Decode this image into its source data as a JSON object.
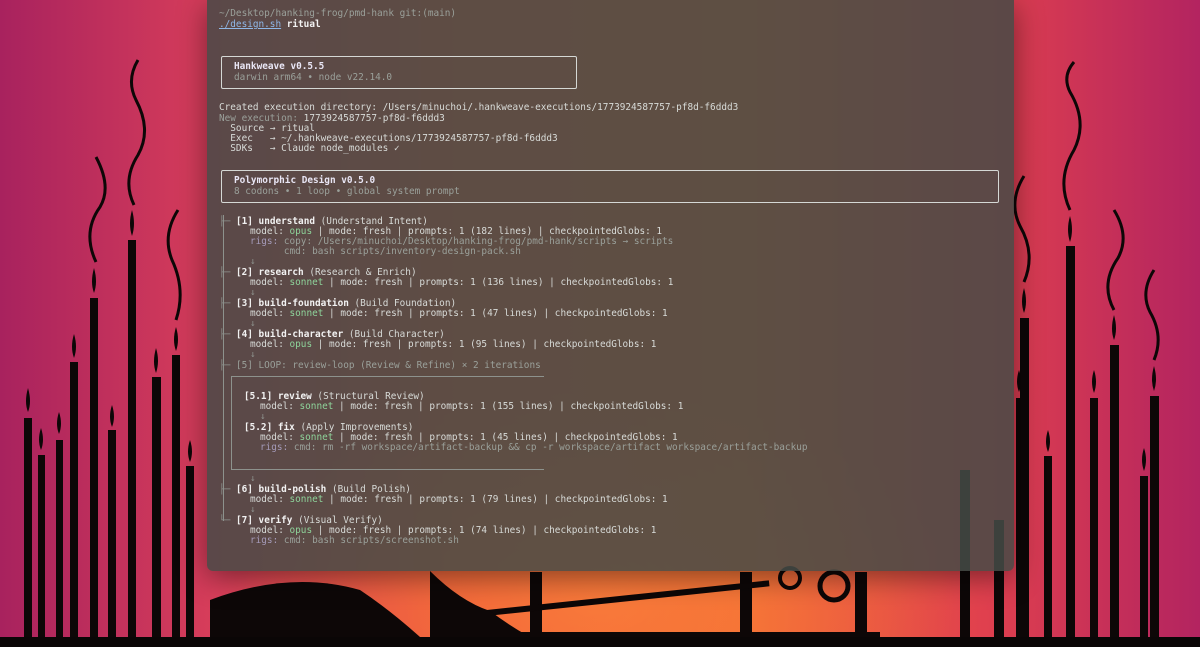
{
  "prompt": {
    "path": "~/Desktop/hanking-frog/pmd-hank git:(main)",
    "command": "./design.sh",
    "arg": "ritual"
  },
  "header_box": {
    "title": "Hankweave v0.5.5",
    "subtitle": "darwin arm64 • node v22.14.0"
  },
  "exec": {
    "created": "Created execution directory: /Users/minuchoi/.hankweave-executions/1773924587757-pf8d-f6ddd3",
    "new_label": "New execution:",
    "new_value": " 1773924587757-pf8d-f6ddd3",
    "source": "  Source → ritual",
    "exec_line": "  Exec   → ~/.hankweave-executions/1773924587757-pf8d-f6ddd3",
    "sdks": "  SDKs   → Claude node_modules ✓"
  },
  "design_box": {
    "title": "Polymorphic Design v0.5.0",
    "subtitle": "8 codons • 1 loop • global system prompt"
  },
  "steps": [
    {
      "id": "[1]",
      "name": "understand",
      "desc": "(Understand Intent)",
      "model_label": "model: ",
      "model": "opus",
      "rest": " | mode: fresh | prompts: 1 (182 lines) | checkpointedGlobs: 1",
      "rigs_label": "rigs:",
      "rigs": " copy: /Users/minuchoi/Desktop/hanking-frog/pmd-hank/scripts → scripts",
      "rigs2": "      cmd: bash scripts/inventory-design-pack.sh"
    },
    {
      "id": "[2]",
      "name": "research",
      "desc": "(Research & Enrich)",
      "model_label": "model: ",
      "model": "sonnet",
      "rest": " | mode: fresh | prompts: 1 (136 lines) | checkpointedGlobs: 1"
    },
    {
      "id": "[3]",
      "name": "build-foundation",
      "desc": "(Build Foundation)",
      "model_label": "model: ",
      "model": "sonnet",
      "rest": " | mode: fresh | prompts: 1 (47 lines) | checkpointedGlobs: 1"
    },
    {
      "id": "[4]",
      "name": "build-character",
      "desc": "(Build Character)",
      "model_label": "model: ",
      "model": "opus",
      "rest": " | mode: fresh | prompts: 1 (95 lines) | checkpointedGlobs: 1"
    }
  ],
  "loop": {
    "label": "[5] LOOP: review-loop (Review & Refine) × 2 iterations",
    "sub": [
      {
        "id": "[5.1]",
        "name": "review",
        "desc": "(Structural Review)",
        "model_label": "model: ",
        "model": "sonnet",
        "rest": " | mode: fresh | prompts: 1 (155 lines) | checkpointedGlobs: 1"
      },
      {
        "id": "[5.2]",
        "name": "fix",
        "desc": "(Apply Improvements)",
        "model_label": "model: ",
        "model": "sonnet",
        "rest": " | mode: fresh | prompts: 1 (45 lines) | checkpointedGlobs: 1",
        "rigs_label": "rigs:",
        "rigs": " cmd: rm -rf workspace/artifact-backup && cp -r workspace/artifact workspace/artifact-backup"
      }
    ]
  },
  "steps_after": [
    {
      "id": "[6]",
      "name": "build-polish",
      "desc": "(Build Polish)",
      "model_label": "model: ",
      "model": "sonnet",
      "rest": " | mode: fresh | prompts: 1 (79 lines) | checkpointedGlobs: 1"
    },
    {
      "id": "[7]",
      "name": "verify",
      "desc": "(Visual Verify)",
      "model_label": "model: ",
      "model": "opus",
      "rest": " | mode: fresh | prompts: 1 (74 lines) | checkpointedGlobs: 1",
      "rigs_label": "rigs:",
      "rigs": " cmd: bash scripts/screenshot.sh"
    }
  ],
  "glyphs": {
    "branch": "├─",
    "last": "└─",
    "arrow": "↓",
    "vbar": "│"
  }
}
